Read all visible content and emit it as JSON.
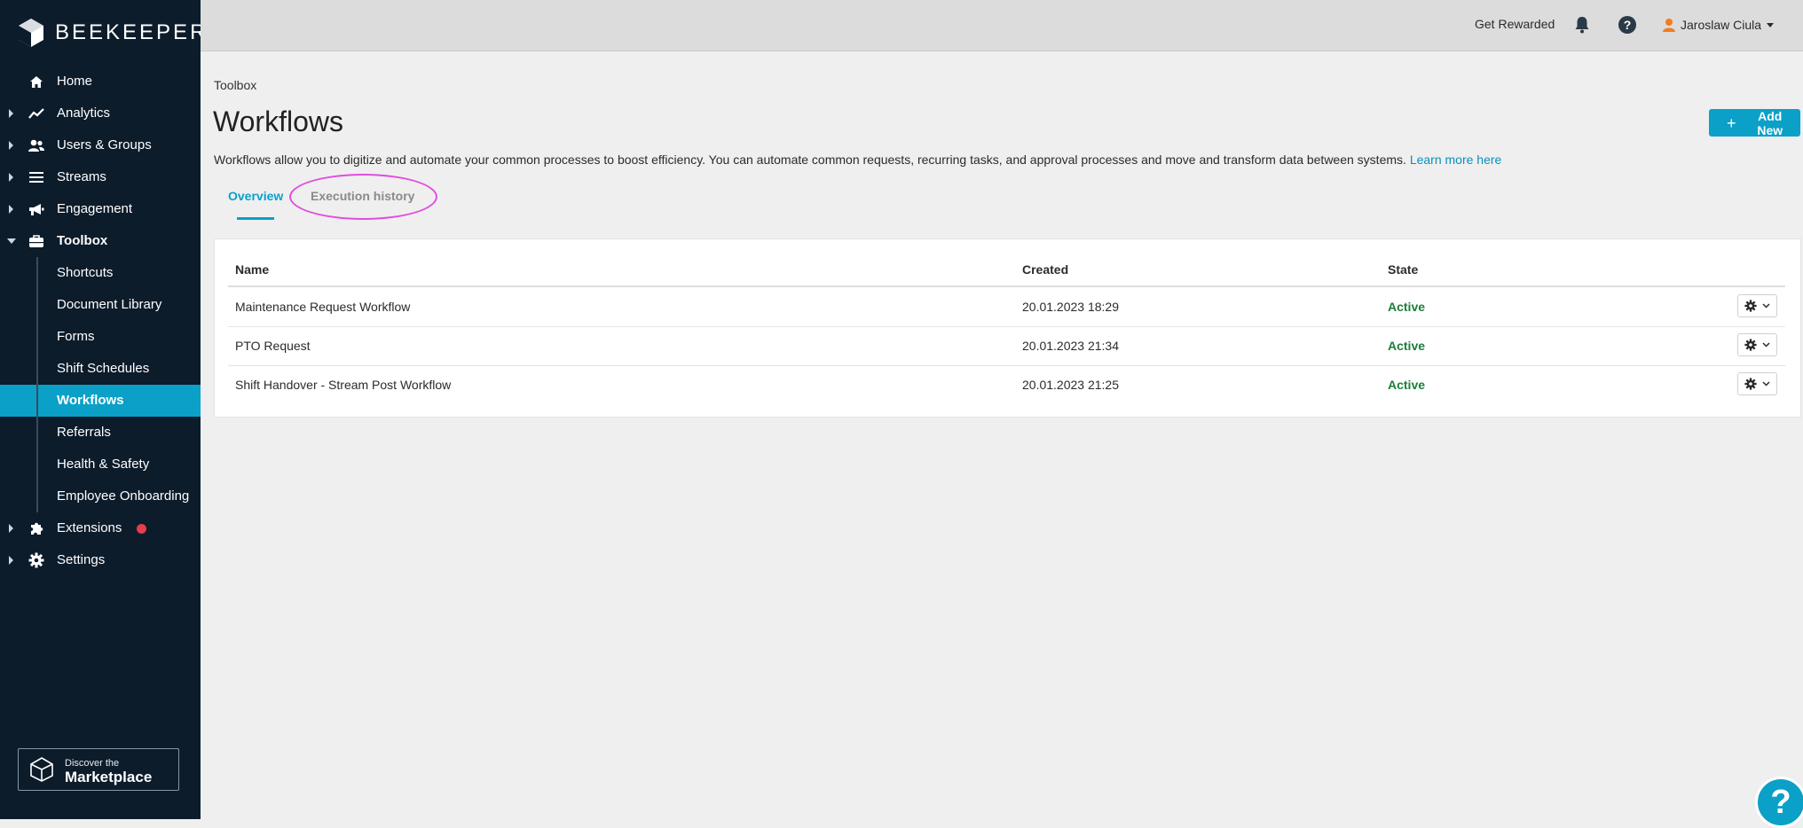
{
  "app": {
    "name": "BEEKEEPER"
  },
  "colors": {
    "accent": "#0aa0c8",
    "sidebar_bg": "#0d1c2b",
    "active_state": "#1a7f3a",
    "notification_dot": "#e53d4b",
    "highlight_ellipse": "#e14de0"
  },
  "sidebar": {
    "items": [
      {
        "label": "Home",
        "icon": "home-icon"
      },
      {
        "label": "Analytics",
        "icon": "analytics-icon"
      },
      {
        "label": "Users & Groups",
        "icon": "users-icon"
      },
      {
        "label": "Streams",
        "icon": "streams-icon"
      },
      {
        "label": "Engagement",
        "icon": "megaphone-icon"
      },
      {
        "label": "Toolbox",
        "icon": "toolbox-icon",
        "expanded": true
      },
      {
        "label": "Extensions",
        "icon": "puzzle-icon",
        "has_notification": true
      },
      {
        "label": "Settings",
        "icon": "gear-icon"
      }
    ],
    "toolbox_subitems": [
      {
        "label": "Shortcuts"
      },
      {
        "label": "Document Library"
      },
      {
        "label": "Forms"
      },
      {
        "label": "Shift Schedules"
      },
      {
        "label": "Workflows",
        "active": true
      },
      {
        "label": "Referrals"
      },
      {
        "label": "Health & Safety"
      },
      {
        "label": "Employee Onboarding"
      }
    ],
    "marketplace": {
      "line1": "Discover the",
      "line2": "Marketplace"
    }
  },
  "topbar": {
    "reward_label": "Get Rewarded",
    "user_name": "Jaroslaw Ciula"
  },
  "main": {
    "breadcrumb": "Toolbox",
    "title": "Workflows",
    "add_button_label": "Add New",
    "description": "Workflows allow you to digitize and automate your common processes to boost efficiency. You can automate common requests, recurring tasks, and approval processes and move and transform data between systems.",
    "learn_more": "Learn more here",
    "tabs": [
      {
        "label": "Overview",
        "active": true
      },
      {
        "label": "Execution history",
        "active": false
      }
    ],
    "table": {
      "columns": [
        "Name",
        "Created",
        "State"
      ],
      "rows": [
        {
          "name": "Maintenance Request Workflow",
          "created": "20.01.2023 18:29",
          "state": "Active"
        },
        {
          "name": "PTO Request",
          "created": "20.01.2023 21:34",
          "state": "Active"
        },
        {
          "name": "Shift Handover - Stream Post Workflow",
          "created": "20.01.2023 21:25",
          "state": "Active"
        }
      ]
    }
  },
  "help_fab": {
    "label": "?"
  }
}
